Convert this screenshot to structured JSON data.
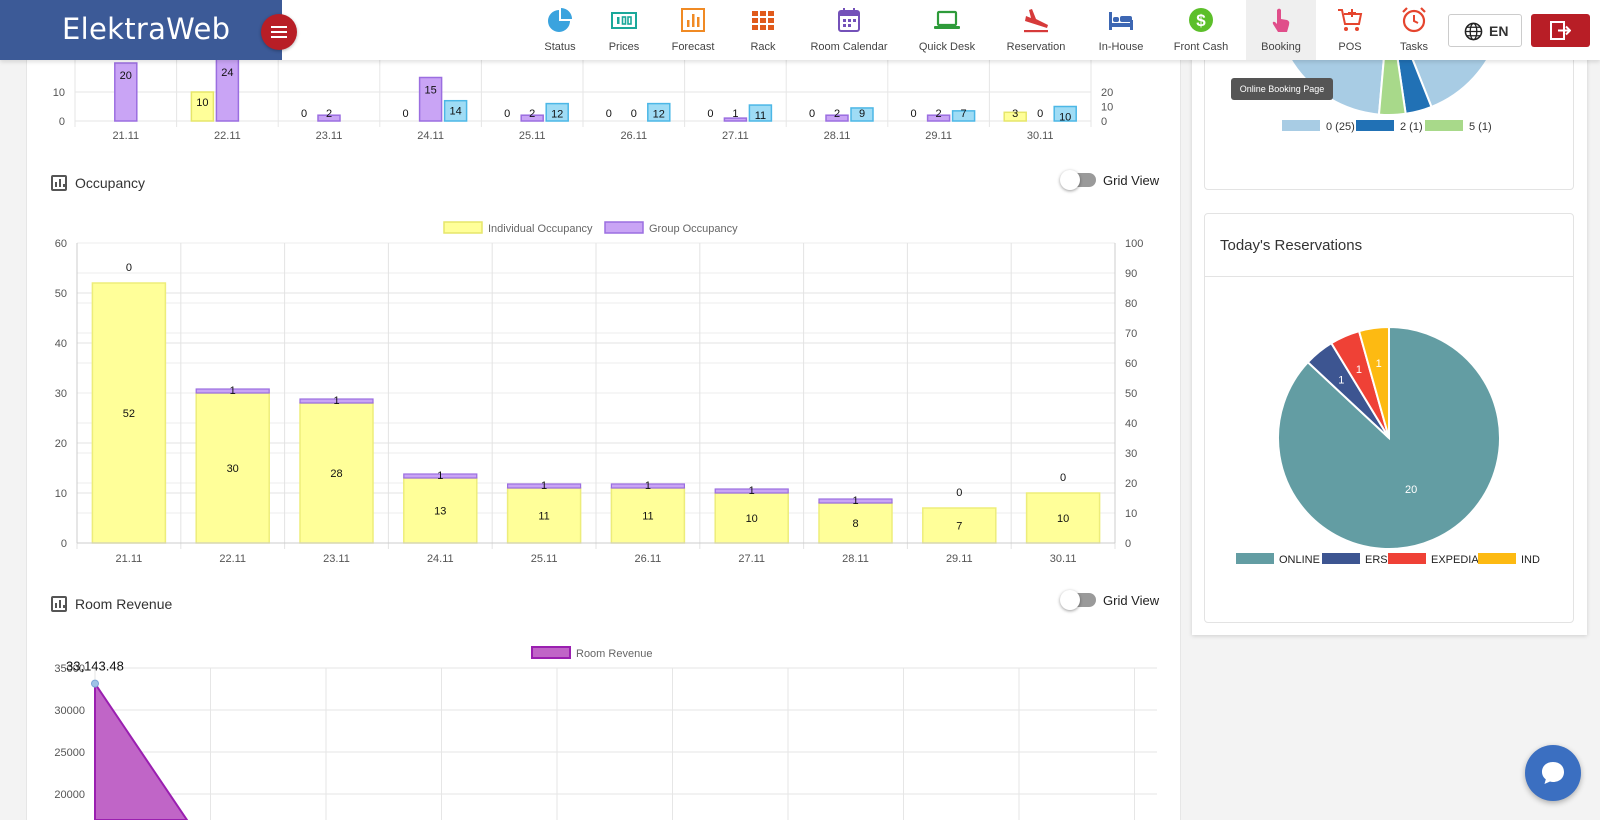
{
  "app": {
    "brand": "ElektraWeb"
  },
  "nav": [
    {
      "id": "status",
      "label": "Status",
      "icon": "pie-chart-icon"
    },
    {
      "id": "prices",
      "label": "Prices",
      "icon": "money-icon"
    },
    {
      "id": "forecast",
      "label": "Forecast",
      "icon": "bar-chart-icon"
    },
    {
      "id": "rack",
      "label": "Rack",
      "icon": "grid-icon"
    },
    {
      "id": "room-calendar",
      "label": "Room Calendar",
      "icon": "calendar-icon"
    },
    {
      "id": "quick-desk",
      "label": "Quick Desk",
      "icon": "laptop-icon"
    },
    {
      "id": "reservation",
      "label": "Reservation",
      "icon": "plane-icon"
    },
    {
      "id": "in-house",
      "label": "In-House",
      "icon": "bed-icon"
    },
    {
      "id": "front-cash",
      "label": "Front Cash",
      "icon": "dollar-icon"
    },
    {
      "id": "booking",
      "label": "Booking",
      "icon": "hand-pointer-icon"
    },
    {
      "id": "pos",
      "label": "POS",
      "icon": "cart-icon"
    },
    {
      "id": "tasks",
      "label": "Tasks",
      "icon": "alarm-clock-icon"
    }
  ],
  "lang": {
    "label": "EN"
  },
  "tooltip": "Online Booking Page",
  "colors": {
    "brand": "#3c5a97",
    "accent": "#b81e26",
    "individual": "#ffff99",
    "group": "#c9a4f5",
    "blue": "#9fdcf5",
    "revenue": "#c065c7"
  },
  "sections": {
    "occupancy": {
      "title": "Occupancy",
      "toggle_label": "Grid View"
    },
    "room_revenue": {
      "title": "Room Revenue",
      "toggle_label": "Grid View"
    },
    "todays_reservations": {
      "title": "Today's Reservations"
    }
  },
  "chart_data": [
    {
      "type": "bar",
      "title": "",
      "categories": [
        "21.11",
        "22.11",
        "23.11",
        "24.11",
        "25.11",
        "26.11",
        "27.11",
        "28.11",
        "29.11",
        "30.11"
      ],
      "series": [
        {
          "values": [
            null,
            10,
            0,
            0,
            0,
            0,
            0,
            0,
            0,
            3
          ]
        },
        {
          "values": [
            20,
            24,
            2,
            15,
            2,
            0,
            1,
            2,
            2,
            0
          ]
        },
        {
          "values": [
            null,
            null,
            null,
            14,
            12,
            12,
            11,
            9,
            7,
            10
          ]
        }
      ],
      "y_left_ticks": [
        0,
        10
      ],
      "y_right_ticks": [
        0,
        10,
        20
      ]
    },
    {
      "type": "bar",
      "stacked": true,
      "title": "",
      "legend": [
        "Individual Occupancy",
        "Group Occupancy"
      ],
      "legend_position": "top",
      "categories": [
        "21.11",
        "22.11",
        "23.11",
        "24.11",
        "25.11",
        "26.11",
        "27.11",
        "28.11",
        "29.11",
        "30.11"
      ],
      "series": [
        {
          "name": "Individual Occupancy",
          "values": [
            52,
            30,
            28,
            13,
            11,
            11,
            10,
            8,
            7,
            10
          ]
        },
        {
          "name": "Group Occupancy",
          "values": [
            0,
            1,
            1,
            1,
            1,
            1,
            1,
            1,
            0,
            0
          ]
        }
      ],
      "ylim": [
        0,
        60
      ],
      "y_left_ticks": [
        0,
        10,
        20,
        30,
        40,
        50,
        60
      ],
      "y2lim": [
        0,
        100
      ],
      "y_right_ticks": [
        0,
        10,
        20,
        30,
        40,
        50,
        60,
        70,
        80,
        90,
        100
      ],
      "grid": true
    },
    {
      "type": "area",
      "title": "",
      "legend": [
        "Room Revenue"
      ],
      "legend_position": "top",
      "series": [
        {
          "name": "Room Revenue",
          "values": [
            33143.48
          ]
        }
      ],
      "point_label": "33,143.48",
      "y_ticks": [
        20000,
        25000,
        30000,
        35000
      ],
      "grid": true
    },
    {
      "type": "pie",
      "title": "",
      "labels": [
        "0 (25)",
        "2 (1)",
        "5 (1)"
      ],
      "values": [
        25,
        1,
        1
      ],
      "colors": [
        "#a8cce4",
        "#2171b5",
        "#a8d98a"
      ],
      "legend_position": "bottom"
    },
    {
      "type": "pie",
      "title": "Today's Reservations",
      "labels": [
        "ONLINE",
        "ERS",
        "EXPEDIA",
        "IND"
      ],
      "values": [
        20,
        1,
        1,
        1
      ],
      "colors": [
        "#639da3",
        "#3d5591",
        "#ef4136",
        "#fdba12"
      ],
      "legend_position": "bottom"
    }
  ]
}
